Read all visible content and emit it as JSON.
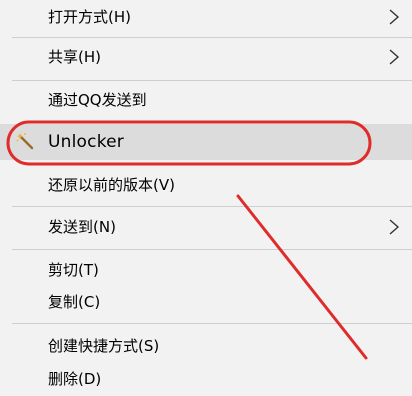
{
  "menu": {
    "items": [
      {
        "label": "打开方式(H)",
        "submenu": true
      },
      {
        "label": "共享(H)",
        "submenu": true
      },
      {
        "label": "通过QQ发送到"
      },
      {
        "label": "Unlocker",
        "icon": "wand-icon",
        "highlighted": true
      },
      {
        "label": "还原以前的版本(V)"
      },
      {
        "label": "发送到(N)",
        "submenu": true
      },
      {
        "label": "剪切(T)"
      },
      {
        "label": "复制(C)"
      },
      {
        "label": "创建快捷方式(S)"
      },
      {
        "label": "删除(D)"
      }
    ]
  },
  "annotation": {
    "circle_color": "#e02b2b",
    "arrow_color": "#e02b2b"
  },
  "colors": {
    "menu_background": "#f2f2f2",
    "highlight_background": "#dcdcdc",
    "separator": "#cfcfcf"
  }
}
